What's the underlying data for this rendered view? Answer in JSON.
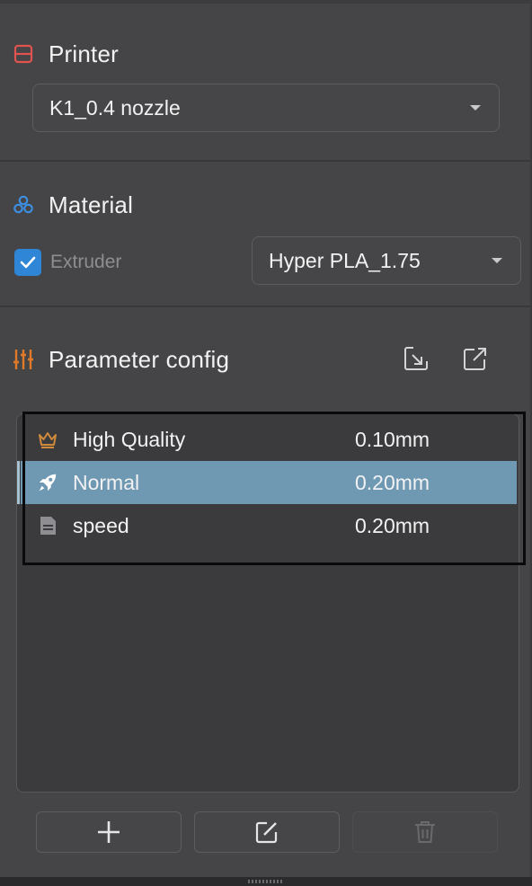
{
  "printer": {
    "heading": "Printer",
    "selected": "K1_0.4 nozzle"
  },
  "material": {
    "heading": "Material",
    "extruder_label": "Extruder",
    "extruder_checked": true,
    "selected": "Hyper PLA_1.75"
  },
  "parameter_config": {
    "heading": "Parameter config",
    "import_icon": "import-icon",
    "export_icon": "export-icon",
    "presets": [
      {
        "name": "High Quality",
        "layer_height": "0.10mm",
        "icon": "crown-icon",
        "selected": false
      },
      {
        "name": "Normal",
        "layer_height": "0.20mm",
        "icon": "rocket-icon",
        "selected": true
      },
      {
        "name": "speed",
        "layer_height": "0.20mm",
        "icon": "document-icon",
        "selected": false
      }
    ]
  },
  "footer_buttons": {
    "add_icon": "plus-icon",
    "edit_icon": "edit-icon",
    "delete_icon": "trash-icon"
  },
  "colors": {
    "background": "#454547",
    "selected_row": "#6f98b3",
    "printer_icon": "#e0534f",
    "material_icon": "#3d8ee0",
    "param_icon": "#e07a2a",
    "checkbox": "#2f86d6"
  }
}
